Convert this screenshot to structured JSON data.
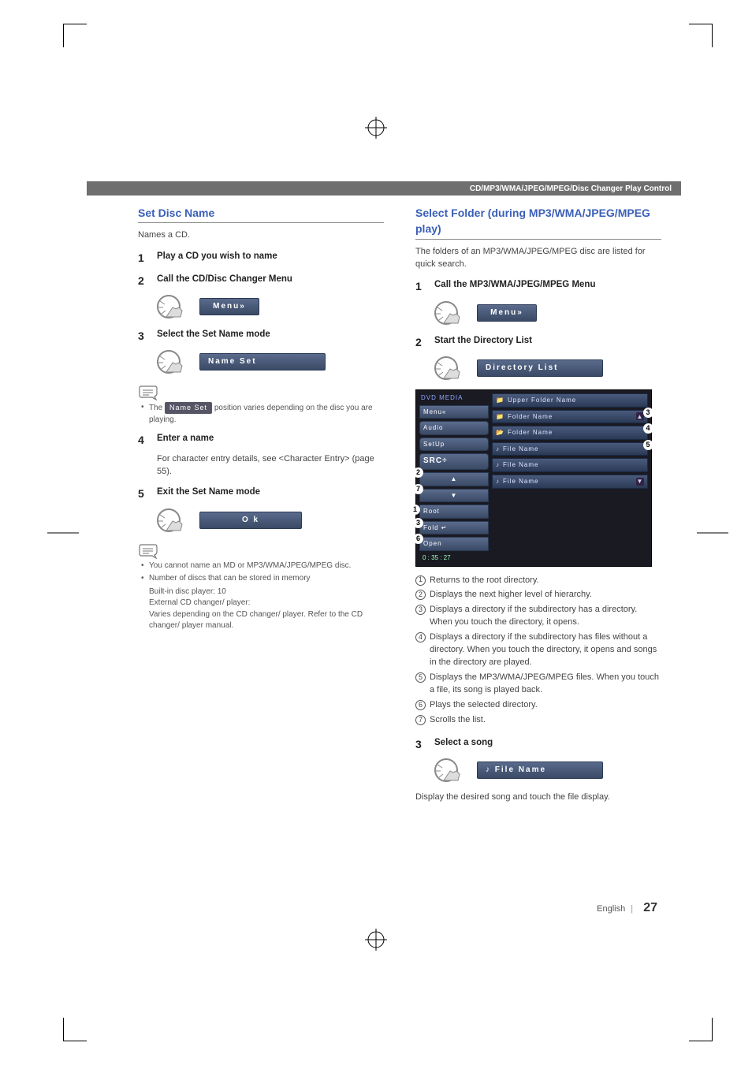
{
  "header": {
    "title": "CD/MP3/WMA/JPEG/MPEG/Disc Changer Play Control"
  },
  "left": {
    "title": "Set Disc Name",
    "desc": "Names a CD.",
    "steps": {
      "s1": {
        "num": "1",
        "title": "Play a CD you wish to name"
      },
      "s2": {
        "num": "2",
        "title": "Call the CD/Disc Changer Menu",
        "btn": "Menu»"
      },
      "s3": {
        "num": "3",
        "title": "Select the Set Name mode",
        "btn": "Name Set"
      },
      "note3a_prefix": "The",
      "note3a_pill": "Name Set",
      "note3a_suffix": "position varies depending on the disc you are playing.",
      "s4": {
        "num": "4",
        "title": "Enter a name",
        "body": "For character entry details, see <Character Entry> (page 55)."
      },
      "s5": {
        "num": "5",
        "title": "Exit the Set Name mode",
        "btn": "O k"
      }
    },
    "notes": [
      "You cannot name an MD or MP3/WMA/JPEG/MPEG disc.",
      "Number of discs that can be stored in memory"
    ],
    "notes_sub": [
      "Built-in disc player: 10",
      "External CD changer/ player:",
      "Varies depending on the CD changer/ player. Refer to the CD changer/ player manual."
    ]
  },
  "right": {
    "title": "Select Folder (during MP3/WMA/JPEG/MPEG play)",
    "desc": "The folders of an MP3/WMA/JPEG/MPEG disc are listed for quick search.",
    "steps": {
      "s1": {
        "num": "1",
        "title": "Call the MP3/WMA/JPEG/MPEG Menu",
        "btn": "Menu»"
      },
      "s2": {
        "num": "2",
        "title": "Start the Directory List",
        "btn": "Directory List"
      },
      "s3": {
        "num": "3",
        "title": "Select a song",
        "btn": "♪ File Name",
        "body": "Display the desired song and touch the file display."
      }
    },
    "dirshot": {
      "brand": "DVD MEDIA",
      "left": {
        "menu": "Menu«",
        "audio": "Audio",
        "setup": "SetUp",
        "src": "SRC÷",
        "up": "▲",
        "down": "▼",
        "root": "Root",
        "fold": "Fold",
        "open": "Open",
        "time": "0 : 35 : 27"
      },
      "right": {
        "upper": "Upper Folder Name",
        "r1": "Folder Name",
        "r2": "Folder Name",
        "r3": "File Name",
        "r4": "File Name",
        "r5": "File Name"
      },
      "badges": {
        "b1": "1",
        "b2": "2",
        "b3": "3",
        "b4": "4",
        "b5": "5",
        "b6": "6",
        "b7": "7"
      }
    },
    "legend": [
      "Returns to the root directory.",
      "Displays the next higher level of hierarchy.",
      "Displays a directory if the subdirectory has a directory. When you touch the directory, it opens.",
      "Displays a directory if the subdirectory has files without a directory. When you touch the directory, it opens and songs in the directory are played.",
      "Displays the MP3/WMA/JPEG/MPEG files. When you touch a file, its song is played back.",
      "Plays the selected directory.",
      "Scrolls the list."
    ]
  },
  "footer": {
    "lang": "English",
    "page": "27"
  }
}
